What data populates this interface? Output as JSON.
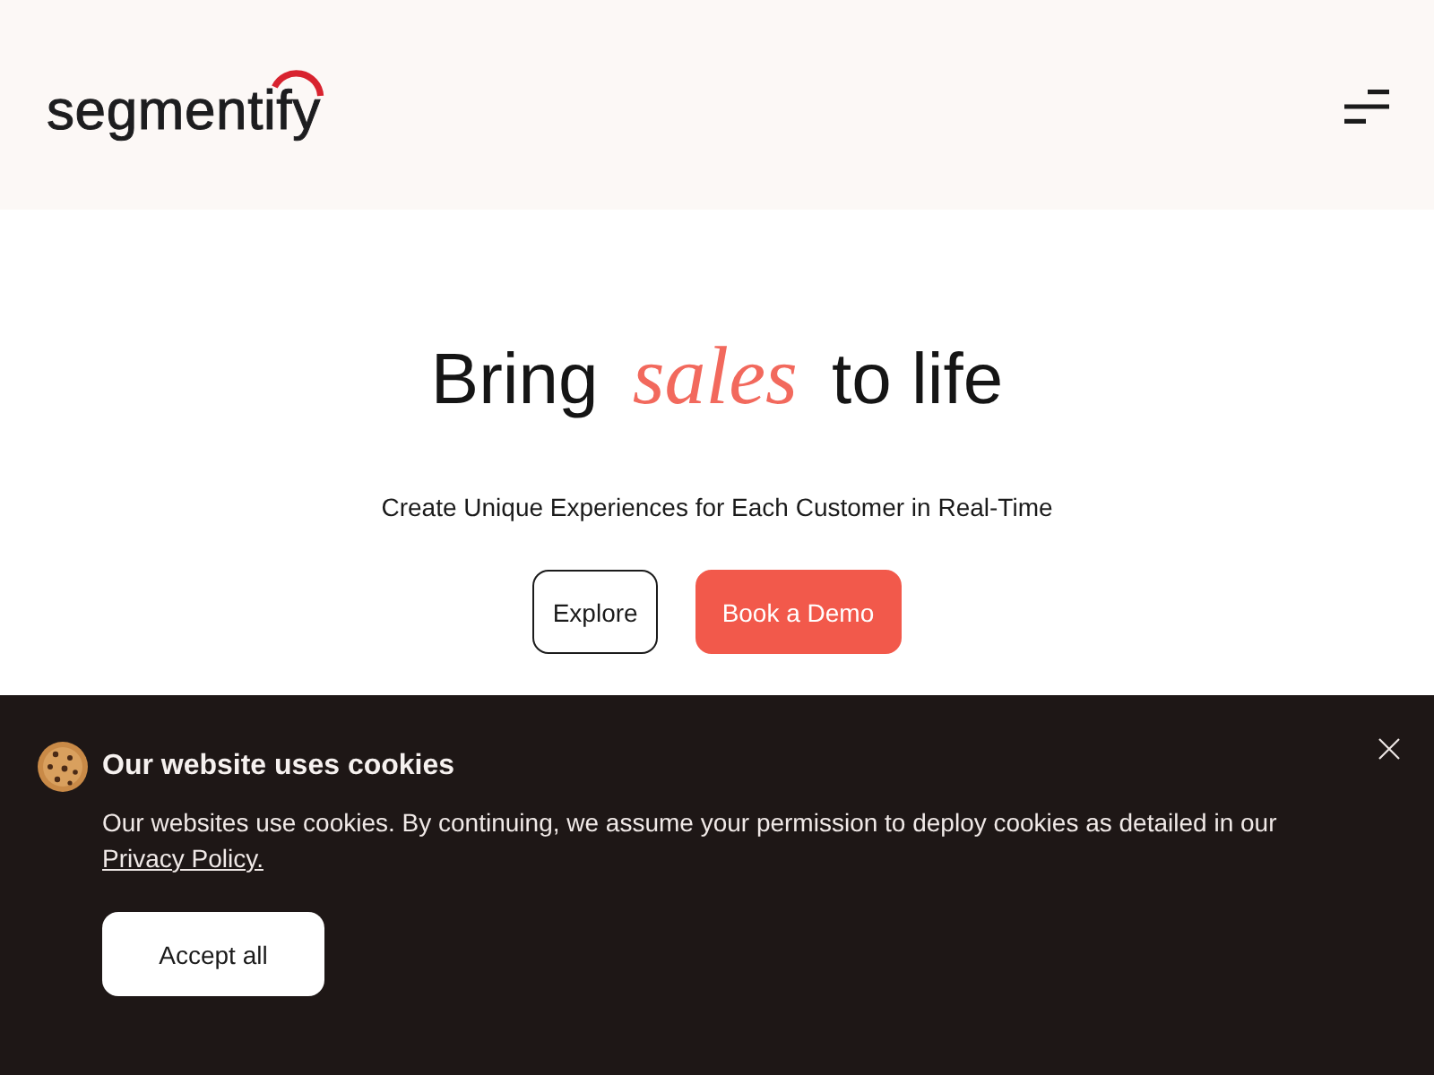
{
  "header": {
    "logo": "segmentify"
  },
  "hero": {
    "headline": "Bring *sales* to life",
    "subtitle": "Create Unique Experiences for Each Customer in Real-Time",
    "buttons": [
      {
        "label": "Explore",
        "kind": "outline"
      },
      {
        "label": "Book a Demo",
        "kind": "primary"
      }
    ]
  },
  "cookie_banner": {
    "title": "Our website uses cookies",
    "text": "Our websites use cookies. By continuing, we assume your permission to deploy cookies as detailed in our",
    "link": "Privacy Policy.",
    "button": "Accept all"
  }
}
